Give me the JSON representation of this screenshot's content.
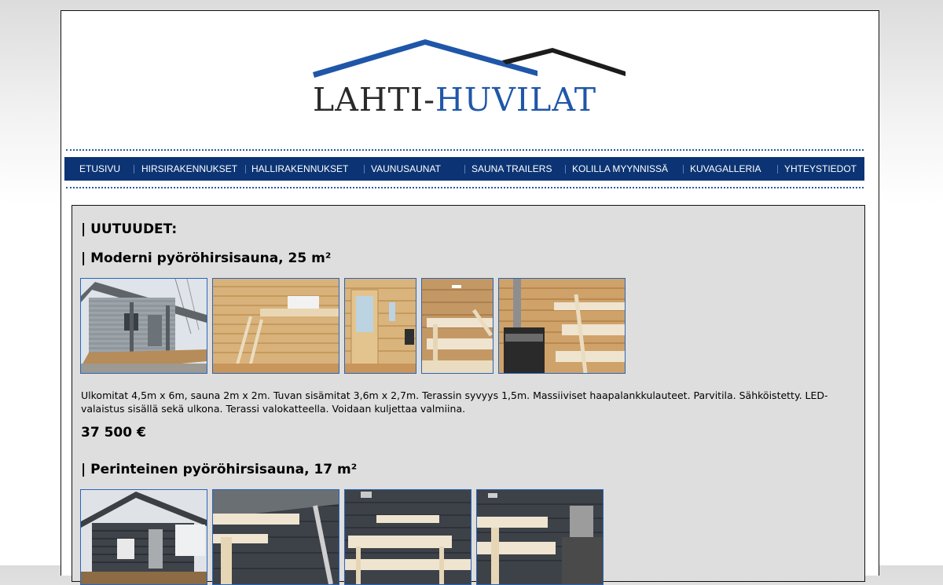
{
  "logo": {
    "part1": "LAHTI-",
    "part2": "HUVILAT"
  },
  "nav": [
    {
      "label": "ETUSIVU"
    },
    {
      "label": "HIRSIRAKENNUKSET"
    },
    {
      "label": "HALLIRAKENNUKSET"
    },
    {
      "label": "VAUNUSAUNAT"
    },
    {
      "label": "SAUNA TRAILERS"
    },
    {
      "label": "KOLILLA MYYNNISSÄ"
    },
    {
      "label": "KUVAGALLERIA"
    },
    {
      "label": "YHTEYSTIEDOT"
    }
  ],
  "section_title": "| UUTUUDET:",
  "products": [
    {
      "title": "| Moderni pyöröhirsisauna, 25 m²",
      "description": "Ulkomitat 4,5m x 6m, sauna 2m x 2m. Tuvan sisämitat 3,6m x 2,7m. Terassin syvyys 1,5m. Massiiviset haapalankkulauteet. Parvitila. Sähköistetty. LED-valaistus sisällä sekä ulkona. Terassi valokatteella. Voidaan kuljettaa valmiina.",
      "price": "37 500 €"
    },
    {
      "title": "| Perinteinen pyöröhirsisauna, 17 m²"
    }
  ],
  "colors": {
    "nav_bg": "#0c3474",
    "accent": "#1f56a8",
    "content_bg": "#dedede"
  }
}
